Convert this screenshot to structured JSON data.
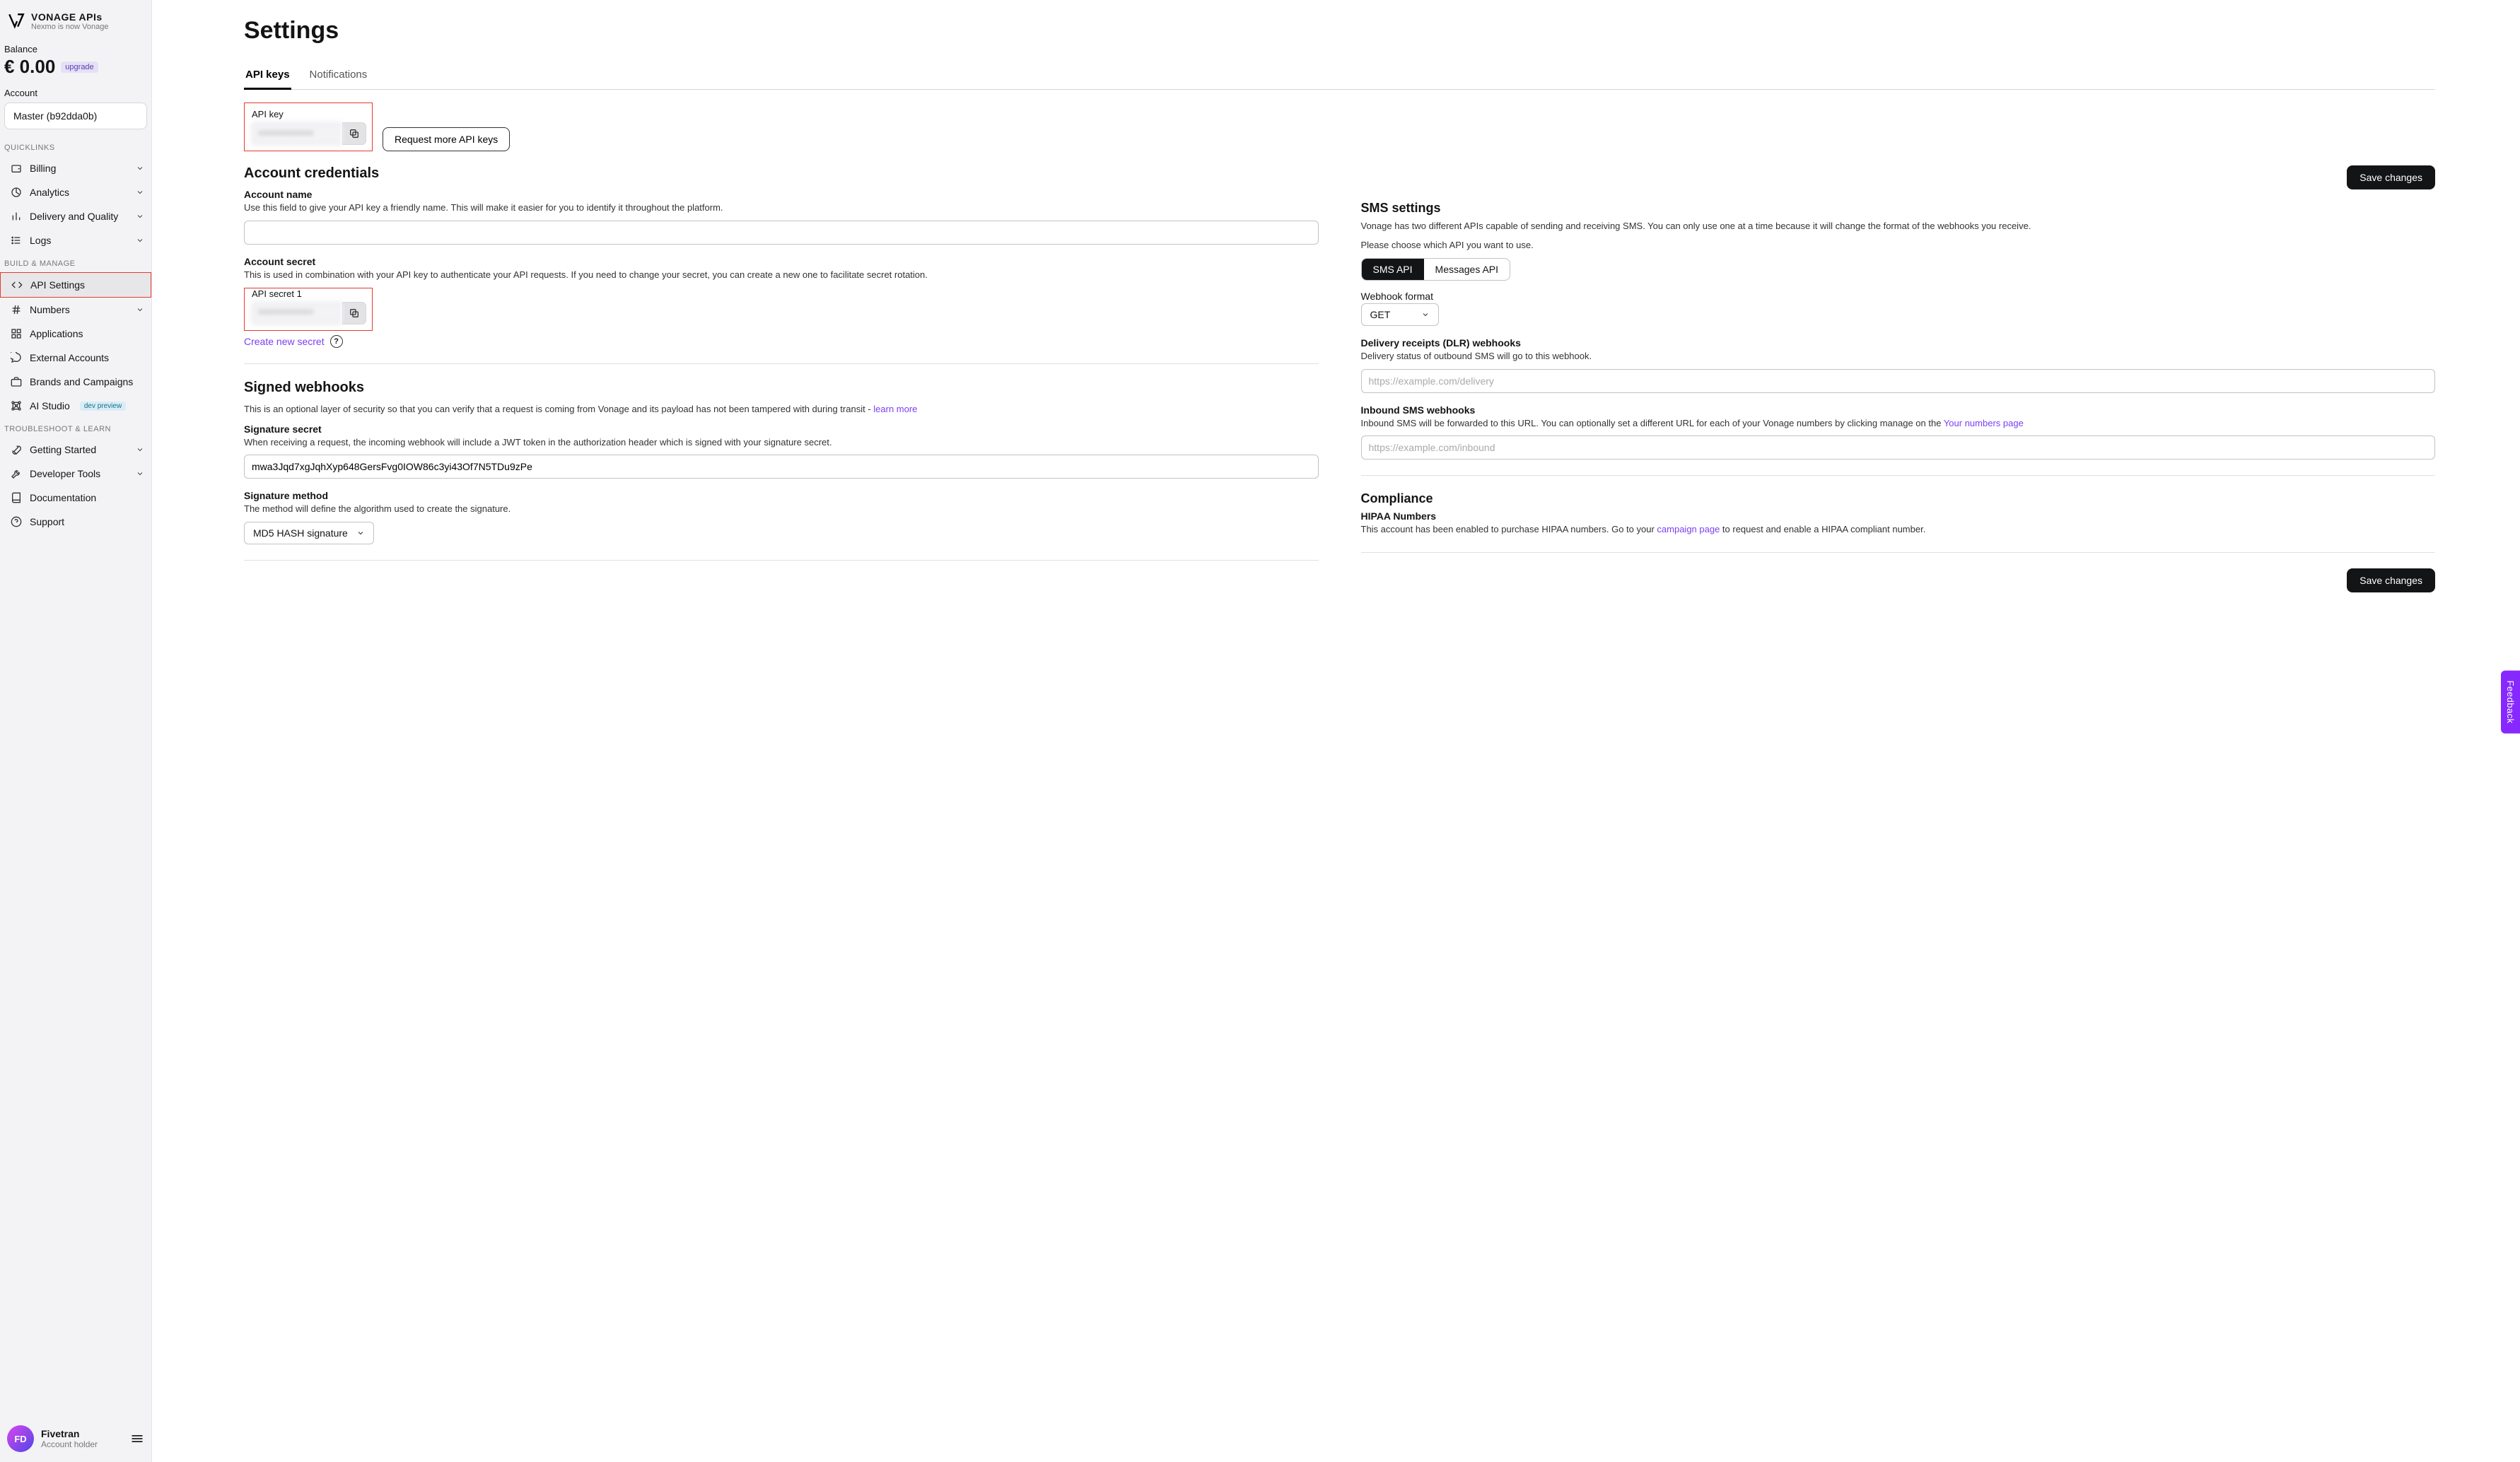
{
  "brand": {
    "title": "VONAGE APIs",
    "subtitle": "Nexmo is now Vonage"
  },
  "balance": {
    "label": "Balance",
    "amount": "€ 0.00",
    "upgrade": "upgrade"
  },
  "account": {
    "label": "Account",
    "selected": "Master (b92dda0b)"
  },
  "sidebar": {
    "quicklinks_header": "QUICKLINKS",
    "quicklinks": [
      {
        "label": "Billing"
      },
      {
        "label": "Analytics"
      },
      {
        "label": "Delivery and Quality"
      },
      {
        "label": "Logs"
      }
    ],
    "build_header": "BUILD & MANAGE",
    "build": [
      {
        "label": "API Settings",
        "active": true
      },
      {
        "label": "Numbers",
        "chev": true
      },
      {
        "label": "Applications"
      },
      {
        "label": "External Accounts"
      },
      {
        "label": "Brands and Campaigns"
      },
      {
        "label": "AI Studio",
        "badge": "dev preview"
      }
    ],
    "troubleshoot_header": "TROUBLESHOOT & LEARN",
    "troubleshoot": [
      {
        "label": "Getting Started",
        "chev": true
      },
      {
        "label": "Developer Tools",
        "chev": true
      },
      {
        "label": "Documentation"
      },
      {
        "label": "Support"
      }
    ]
  },
  "user": {
    "initials": "FD",
    "name": "Fivetran",
    "role": "Account holder"
  },
  "page": {
    "title": "Settings"
  },
  "tabs": {
    "api_keys": "API keys",
    "notifications": "Notifications"
  },
  "api_key": {
    "label": "API key",
    "value": "••••••••••",
    "request_more": "Request more API keys"
  },
  "credentials": {
    "title": "Account credentials",
    "save": "Save changes",
    "account_name": {
      "title": "Account name",
      "desc": "Use this field to give your API key a friendly name. This will make it easier for you to identify it throughout the platform."
    },
    "account_secret": {
      "title": "Account secret",
      "desc": "This is used in combination with your API key to authenticate your API requests. If you need to change your secret, you can create a new one to facilitate secret rotation.",
      "field_label": "API secret 1",
      "value": "••••••••••",
      "create": "Create new secret"
    }
  },
  "signed": {
    "title": "Signed webhooks",
    "desc_1": "This is an optional layer of security so that you can verify that a request is coming from Vonage and its payload has not been tampered with during transit - ",
    "learn_more": "learn more",
    "sig_secret": {
      "title": "Signature secret",
      "desc": "When receiving a request, the incoming webhook will include a JWT token in the authorization header which is signed with your signature secret.",
      "value": "mwa3Jqd7xgJqhXyp648GersFvg0IOW86c3yi43Of7N5TDu9zPe"
    },
    "sig_method": {
      "title": "Signature method",
      "desc": "The method will define the algorithm used to create the signature.",
      "selected": "MD5 HASH signature"
    }
  },
  "sms": {
    "title": "SMS settings",
    "desc1": "Vonage has two different APIs capable of sending and receiving SMS. You can only use one at a time because it will change the format of the webhooks you receive.",
    "desc2": "Please choose which API you want to use.",
    "opt_sms": "SMS API",
    "opt_messages": "Messages API",
    "webhook_format": {
      "title": "Webhook format",
      "selected": "GET"
    },
    "dlr": {
      "title": "Delivery receipts (DLR) webhooks",
      "desc": "Delivery status of outbound SMS will go to this webhook.",
      "placeholder": "https://example.com/delivery"
    },
    "inbound": {
      "title": "Inbound SMS webhooks",
      "desc_pre": "Inbound SMS will be forwarded to this URL. You can optionally set a different URL for each of your Vonage numbers by clicking manage on the ",
      "link": "Your numbers page",
      "placeholder": "https://example.com/inbound"
    }
  },
  "compliance": {
    "title": "Compliance",
    "hipaa_title": "HIPAA Numbers",
    "desc_pre": "This account has been enabled to purchase HIPAA numbers. Go to your ",
    "link": "campaign page",
    "desc_post": " to request and enable a HIPAA compliant number."
  },
  "save_bottom": "Save changes",
  "feedback": "Feedback"
}
